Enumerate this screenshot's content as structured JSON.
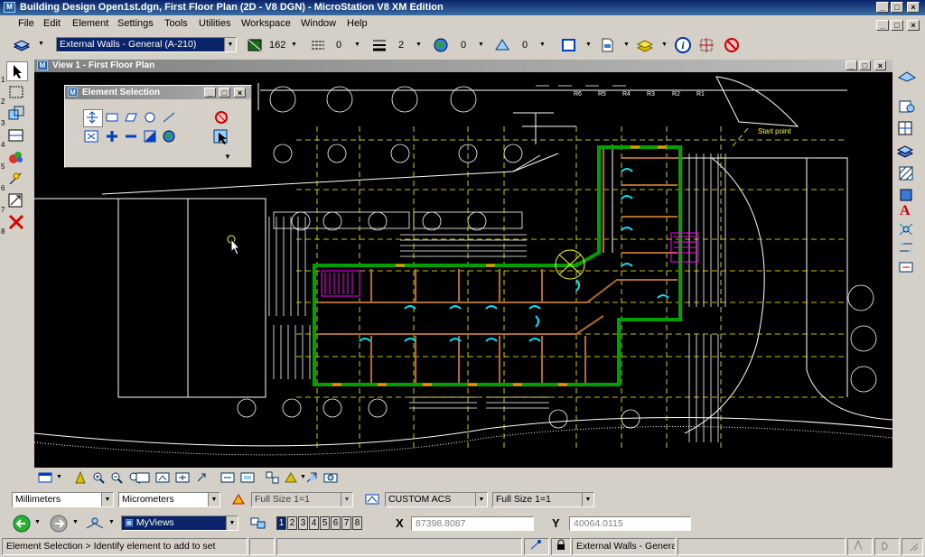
{
  "window": {
    "title": "Building Design Open1st.dgn, First Floor Plan (2D - V8 DGN) - MicroStation V8 XM Edition",
    "min": "_",
    "max": "□",
    "close": "×"
  },
  "menubar": [
    {
      "label": "File"
    },
    {
      "label": "Edit"
    },
    {
      "label": "Element"
    },
    {
      "label": "Settings"
    },
    {
      "label": "Tools"
    },
    {
      "label": "Utilities"
    },
    {
      "label": "Workspace"
    },
    {
      "label": "Window"
    },
    {
      "label": "Help"
    }
  ],
  "attributes": {
    "level": "External Walls - General (A-210)",
    "color_value": "162",
    "style_value": "0",
    "weight_value": "2",
    "class_value": "0",
    "transparency_value": "0"
  },
  "view": {
    "title": "View 1 - First Floor Plan",
    "start_point_label": "Start point",
    "row_labels": [
      "R6",
      "R5",
      "R4",
      "R3",
      "R2",
      "R1"
    ]
  },
  "element_selection": {
    "title": "Element Selection"
  },
  "left_tool_numbers": [
    "1",
    "2",
    "3",
    "4",
    "5",
    "6",
    "7",
    "8"
  ],
  "units": {
    "master": "Millimeters",
    "sub": "Micrometers",
    "scale1": "Full Size 1=1",
    "acs": "CUSTOM ACS",
    "scale2": "Full Size 1=1"
  },
  "nav": {
    "myviews": "MyViews",
    "view_numbers": [
      "1",
      "2",
      "3",
      "4",
      "5",
      "6",
      "7",
      "8"
    ],
    "x_label": "X",
    "x_value": "87398.8087",
    "y_label": "Y",
    "y_value": "40064.0115"
  },
  "status": {
    "message": "Element Selection > Identify element to add to set",
    "active_level": "External Walls - Genera"
  },
  "colors": {
    "title_blue": "#0a246a",
    "wall_green": "#00a000",
    "grid_yellow": "#ffff00",
    "door_cyan": "#00e5ff",
    "wall_brown": "#b06a2a",
    "stair_magenta": "#ff00ff"
  }
}
